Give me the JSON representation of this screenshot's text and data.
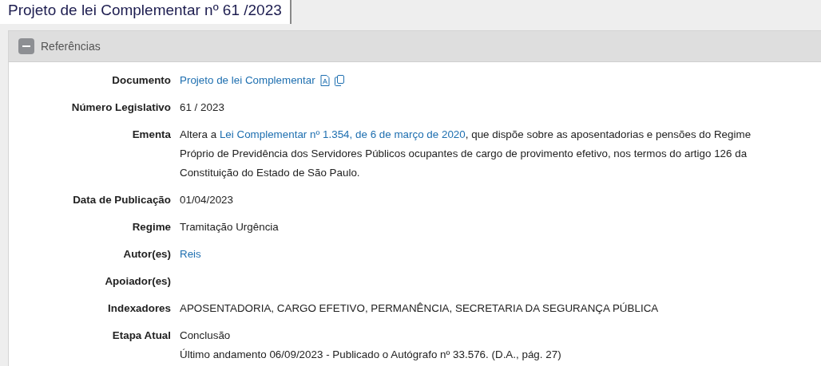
{
  "tab": {
    "title": "Projeto de lei Complementar nº 61 /2023",
    "selected": true
  },
  "panel": {
    "title": "Referências",
    "expanded": true
  },
  "rows": [
    {
      "kind": "document",
      "label": "Documento",
      "value": "Projeto de lei Complementar"
    },
    {
      "kind": "text",
      "label": "Número Legislativo",
      "value": "61 / 2023"
    },
    {
      "kind": "rich",
      "label": "Ementa",
      "parts": [
        {
          "text": "Altera a ",
          "link": false
        },
        {
          "text": "Lei Complementar nº 1.354, de 6 de março de 2020",
          "link": true
        },
        {
          "text": ", que dispõe sobre as aposentadorias e pensões do Regime Próprio de Previdência dos Servidores Públicos ocupantes de cargo de provimento efetivo, nos termos do artigo 126 da Constituição do Estado de São Paulo.",
          "link": false
        }
      ]
    },
    {
      "kind": "text",
      "label": "Data de Publicação",
      "value": "01/04/2023"
    },
    {
      "kind": "text",
      "label": "Regime",
      "value": "Tramitação Urgência"
    },
    {
      "kind": "link",
      "label": "Autor(es)",
      "value": "Reis"
    },
    {
      "kind": "empty",
      "label": "Apoiador(es)"
    },
    {
      "kind": "text",
      "label": "Indexadores",
      "value": "APOSENTADORIA, CARGO EFETIVO, PERMANÊNCIA, SECRETARIA DA SEGURANÇA PÚBLICA"
    },
    {
      "kind": "lines",
      "label": "Etapa Atual",
      "lines": [
        "Conclusão",
        "Último andamento 06/09/2023 - Publicado o Autógrafo nº 33.576. (D.A., pág. 27)"
      ]
    }
  ]
}
